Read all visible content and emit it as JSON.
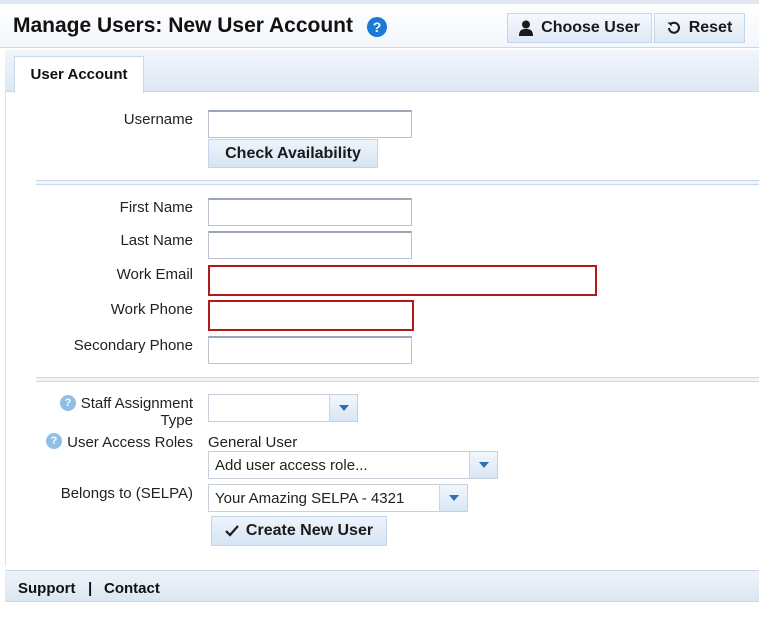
{
  "header": {
    "title": "Manage Users: New User Account",
    "help_glyph": "?",
    "choose_user_label": "Choose User",
    "reset_label": "Reset"
  },
  "tabs": [
    {
      "label": "User Account",
      "active": true
    }
  ],
  "form": {
    "username_label": "Username",
    "username_value": "",
    "check_availability_label": "Check Availability",
    "first_name_label": "First Name",
    "first_name_value": "",
    "last_name_label": "Last Name",
    "last_name_value": "",
    "work_email_label": "Work Email",
    "work_email_value": "",
    "work_phone_label": "Work Phone",
    "work_phone_value": "",
    "secondary_phone_label": "Secondary Phone",
    "secondary_phone_value": "",
    "staff_assignment_label_1": "Staff Assignment",
    "staff_assignment_label_2": "Type",
    "staff_assignment_value": "",
    "user_access_roles_label": "User Access Roles",
    "user_access_roles_current": "General User",
    "add_role_placeholder": "Add user access role...",
    "belongs_to_label": "Belongs to (SELPA)",
    "belongs_to_value": "Your Amazing SELPA - 4321",
    "create_button_label": "Create New User"
  },
  "footer": {
    "support_label": "Support",
    "separator": "|",
    "contact_label": "Contact"
  },
  "icons": {
    "help": "help-icon",
    "user": "user-icon",
    "reset": "reset-icon",
    "check": "checkmark-icon",
    "dropdown": "chevron-down-icon"
  },
  "colors": {
    "help_blue": "#1a7ad6",
    "error_border": "#b31b1b",
    "header_bg": "#f3f7fc",
    "accent_light": "#dde8f5"
  }
}
